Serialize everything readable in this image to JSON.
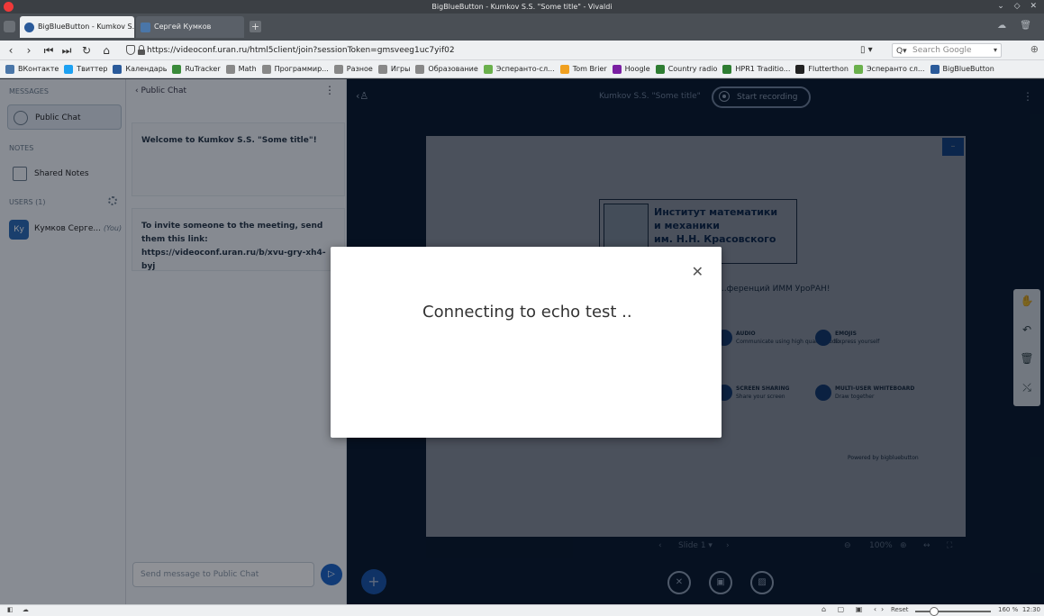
{
  "window": {
    "title": "BigBlueButton - Kumkov S.S. \"Some title\" - Vivaldi"
  },
  "tabs": [
    {
      "label": "BigBlueButton - Kumkov S.S.",
      "active": true
    },
    {
      "label": "Сергей Кумков",
      "active": false
    }
  ],
  "address_bar": {
    "url": "https://videoconf.uran.ru/html5client/join?sessionToken=gmsveeg1uc7yif02",
    "search_placeholder": "Search Google"
  },
  "bookmarks": [
    {
      "label": "ВКонтакте",
      "icon": "vk-icon",
      "color": "#4a76a8"
    },
    {
      "label": "Твиттер",
      "icon": "twitter-icon",
      "color": "#1da1f2"
    },
    {
      "label": "Календарь",
      "icon": "calendar-icon",
      "color": "#2a5a9a"
    },
    {
      "label": "RuTracker",
      "icon": "rutracker-icon",
      "color": "#3a8a3a"
    },
    {
      "label": "Math",
      "icon": "folder-icon",
      "color": "#888888"
    },
    {
      "label": "Программир...",
      "icon": "folder-icon",
      "color": "#888888"
    },
    {
      "label": "Разное",
      "icon": "folder-icon",
      "color": "#888888"
    },
    {
      "label": "Игры",
      "icon": "folder-icon",
      "color": "#888888"
    },
    {
      "label": "Образование",
      "icon": "folder-icon",
      "color": "#888888"
    },
    {
      "label": "Эсперанто-сл...",
      "icon": "star-icon",
      "color": "#6ab04c"
    },
    {
      "label": "Tom Brier",
      "icon": "tombrier-icon",
      "color": "#f0a020"
    },
    {
      "label": "Hoogle",
      "icon": "lambda-icon",
      "color": "#7a1fa2"
    },
    {
      "label": "Country radio",
      "icon": "radio-icon",
      "color": "#2e7d32"
    },
    {
      "label": "HPR1 Traditio...",
      "icon": "radio-icon",
      "color": "#2e7d32"
    },
    {
      "label": "Flutterthon",
      "icon": "github-icon",
      "color": "#222222"
    },
    {
      "label": "Эсперанто сл...",
      "icon": "star-icon",
      "color": "#6ab04c"
    },
    {
      "label": "BigBlueButton",
      "icon": "bbb-icon",
      "color": "#2a5a9a"
    }
  ],
  "userlist": {
    "messages_title": "MESSAGES",
    "public_chat": "Public Chat",
    "notes_title": "NOTES",
    "shared_notes": "Shared Notes",
    "users_title": "USERS (1)",
    "user_initials": "Ку",
    "user_name": "Кумков Серге...",
    "user_you": "(You)"
  },
  "chat": {
    "header": "Public Chat",
    "welcome_prefix": "Welcome to ",
    "welcome_name": "Kumkov S.S. \"Some title\"",
    "welcome_suffix": "!",
    "invite": "To invite someone to the meeting, send them this link: https://videoconf.uran.ru/b/xvu-gry-xh4-byj",
    "input_placeholder": "Send message to Public Chat"
  },
  "main": {
    "meeting_title": "Kumkov S.S. \"Some title\"",
    "record_label": "Start recording"
  },
  "slide": {
    "logo_line1": "Институт математики",
    "logo_line2": "и механики",
    "logo_line3": "им. Н.Н. Красовского",
    "subtitle": "...ференций ИММ УроРАН!",
    "features": [
      {
        "title": "AUDIO",
        "desc": "Communicate using high quality audio"
      },
      {
        "title": "EMOJIS",
        "desc": "Express yourself"
      },
      {
        "title": "SCREEN SHARING",
        "desc": "Share your screen"
      },
      {
        "title": "MULTI-USER WHITEBOARD",
        "desc": "Draw together"
      }
    ],
    "powered_by": "Powered by bigbluebutton"
  },
  "slide_controls": {
    "slide_label": "Slide 1",
    "zoom": "100%"
  },
  "modal": {
    "message": "Connecting to echo test .."
  },
  "statusbar": {
    "reset_label": "Reset",
    "zoom_level": "160 %",
    "zoom_fraction": 0.25,
    "clock": "12:30"
  }
}
